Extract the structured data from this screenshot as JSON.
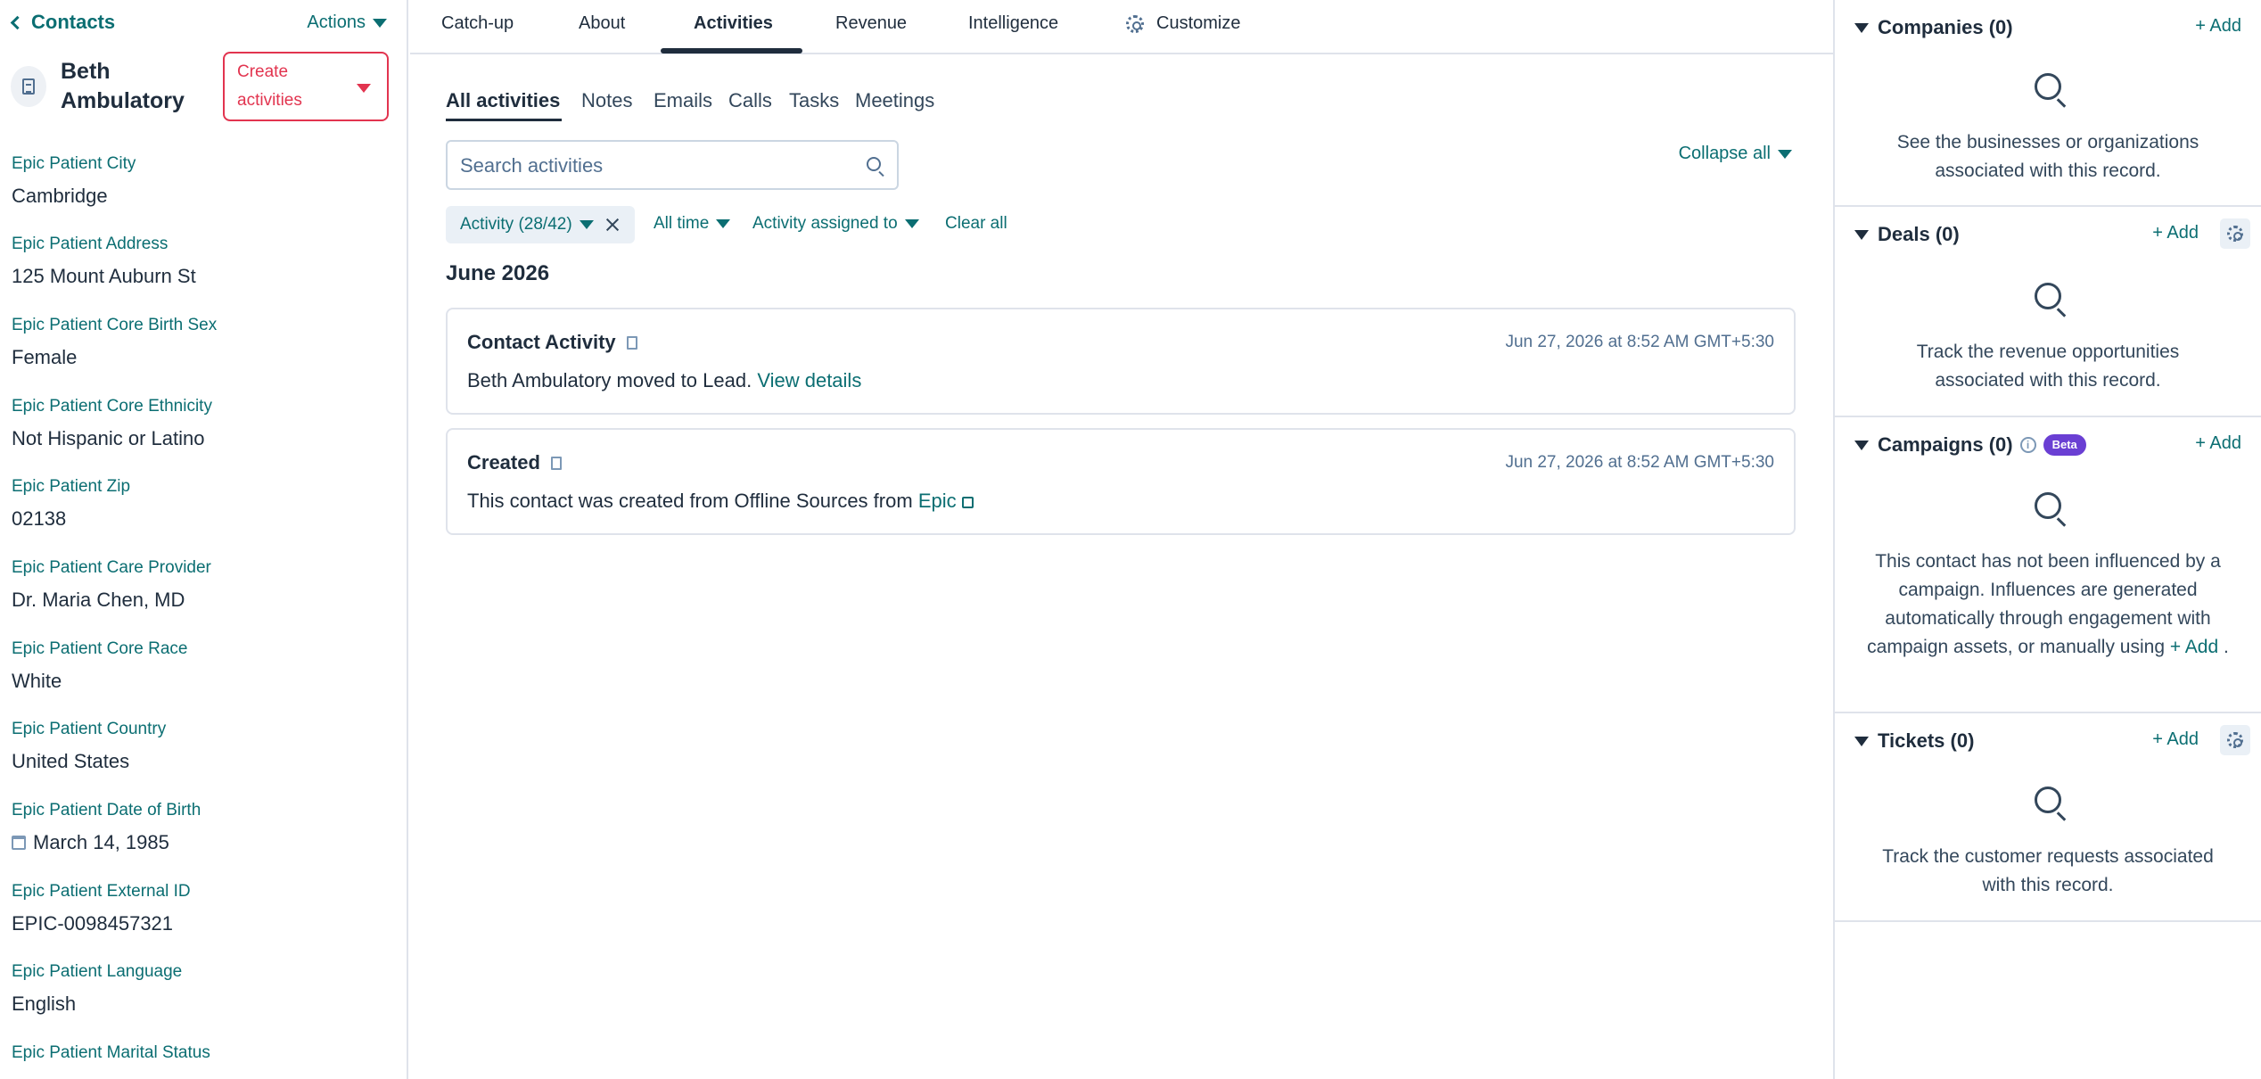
{
  "left": {
    "back_label": "Contacts",
    "actions_label": "Actions",
    "record_name": "Beth Ambulatory",
    "create_label": "Create activities",
    "properties": [
      {
        "label": "Epic Patient City",
        "value": "Cambridge"
      },
      {
        "label": "Epic Patient Address",
        "value": "125 Mount Auburn St"
      },
      {
        "label": "Epic Patient Core Birth Sex",
        "value": "Female"
      },
      {
        "label": "Epic Patient Core Ethnicity",
        "value": "Not Hispanic or Latino"
      },
      {
        "label": "Epic Patient Zip",
        "value": "02138"
      },
      {
        "label": "Epic Patient Care Provider",
        "value": "Dr. Maria Chen, MD"
      },
      {
        "label": "Epic Patient Core Race",
        "value": "White"
      },
      {
        "label": "Epic Patient Country",
        "value": "United States"
      },
      {
        "label": "Epic Patient Date of Birth",
        "value": "March 14, 1985"
      },
      {
        "label": "Epic Patient External ID",
        "value": "EPIC-0098457321"
      },
      {
        "label": "Epic Patient Language",
        "value": "English"
      },
      {
        "label": "Epic Patient Marital Status",
        "value": ""
      }
    ]
  },
  "topnav": {
    "tabs": [
      "Catch-up",
      "About",
      "Activities",
      "Revenue",
      "Intelligence",
      "Customize"
    ],
    "active": "Activities"
  },
  "subtabs": {
    "items": [
      "All activities",
      "Notes",
      "Emails",
      "Calls",
      "Tasks",
      "Meetings"
    ],
    "active": "All activities"
  },
  "search": {
    "placeholder": "Search activities"
  },
  "collapse_all": "Collapse all",
  "filters": {
    "chip": "Activity (28/42)",
    "time": "All time",
    "assigned": "Activity assigned to",
    "clear": "Clear all"
  },
  "month_heading": "June 2026",
  "activities": [
    {
      "title": "Contact Activity",
      "date": "Jun 27, 2026 at 8:52 AM GMT+5:30",
      "body": "Beth Ambulatory moved to Lead.",
      "link": "View details"
    },
    {
      "title": "Created",
      "date": "Jun 27, 2026 at 8:52 AM GMT+5:30",
      "body": "This contact was created from Offline Sources from",
      "link": "Epic"
    }
  ],
  "right": {
    "add_label": "+ Add",
    "companies": {
      "title": "Companies (0)",
      "empty": "See the businesses or organizations associated with this record."
    },
    "deals": {
      "title": "Deals (0)",
      "empty": "Track the revenue opportunities associated with this record."
    },
    "campaigns": {
      "title": "Campaigns (0)",
      "badge": "Beta",
      "info_glyph": "i",
      "empty": "This contact has not been influenced by a campaign. Influences are generated automatically through engagement with campaign assets, or manually using",
      "inline_add": "+ Add",
      "empty_end": "."
    },
    "tickets": {
      "title": "Tickets (0)",
      "empty": "Track the customer requests associated with this record."
    }
  },
  "colors": {
    "accent": "#0b6e72",
    "create_button": "#e2344f",
    "beta_badge": "#6a3fd3"
  },
  "icons": [
    "chevron-left-icon",
    "caret-down-icon",
    "record-doc-icon",
    "gear-icon",
    "search-icon",
    "close-icon",
    "calendar-icon",
    "external-link-icon",
    "info-icon",
    "empty-search-icon"
  ]
}
